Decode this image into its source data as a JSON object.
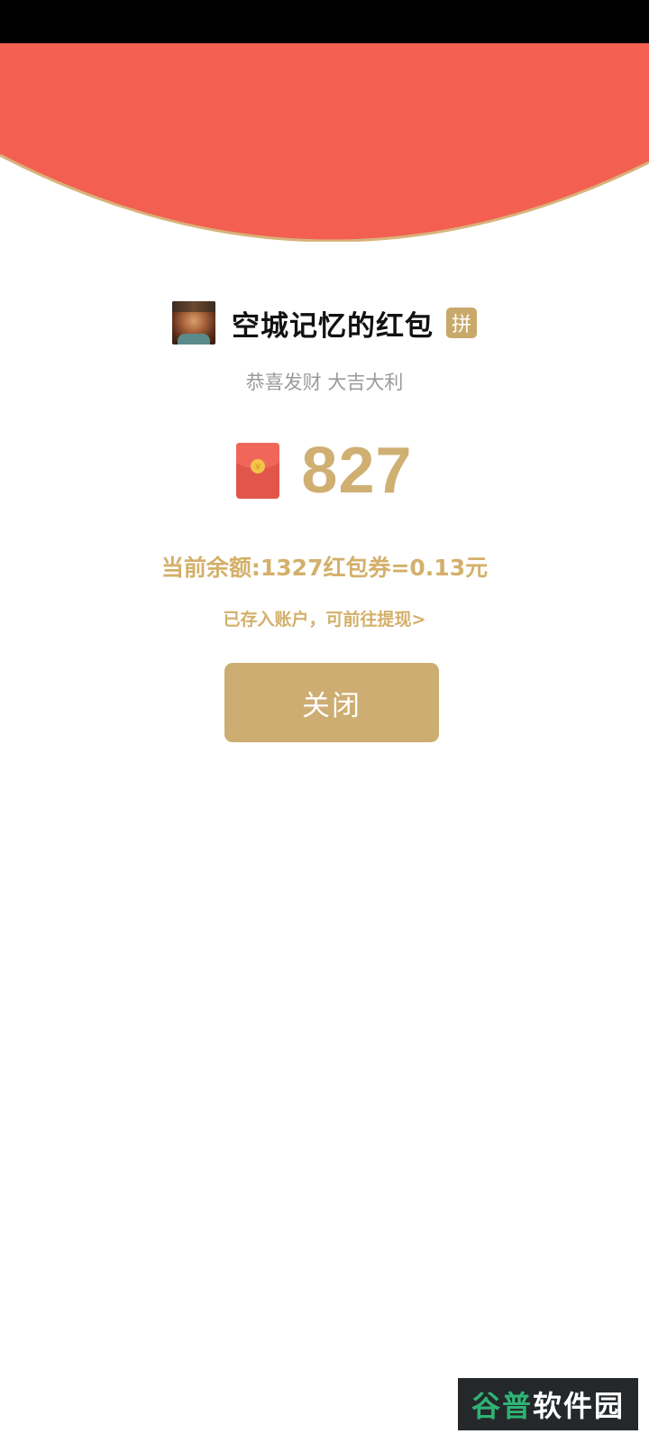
{
  "status_bar": {},
  "header": {
    "colors": {
      "red": "#f35f50",
      "border": "#d8b27a"
    }
  },
  "sender": {
    "avatar_icon": "profile-photo",
    "name": "空城记忆的红包",
    "badge": "拼"
  },
  "greeting": "恭喜发财 大吉大利",
  "reward": {
    "icon": "red-envelope-icon",
    "amount": "827",
    "accent_color": "#cfb072"
  },
  "balance_text": "当前余额:1327红包券=0.13元",
  "deposit_note": "已存入账户，可前往提现>",
  "close_button": {
    "label": "关闭",
    "color": "#cdad72"
  },
  "watermark": {
    "part_green": "谷普",
    "part_white": "软件园"
  }
}
